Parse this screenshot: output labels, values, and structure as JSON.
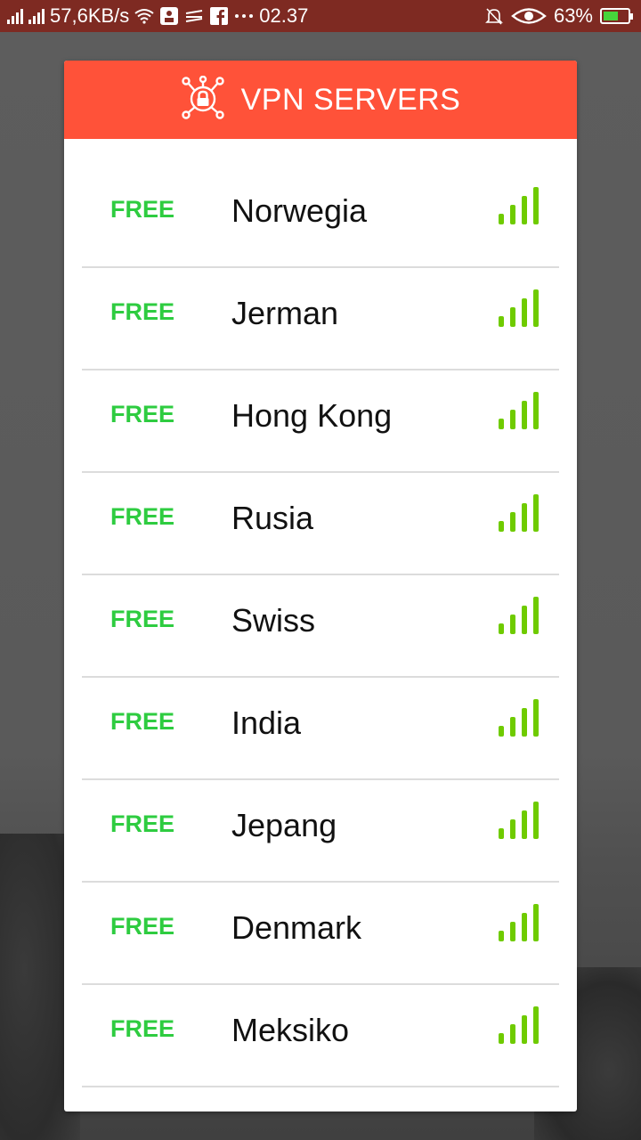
{
  "status_bar": {
    "network_speed": "57,6KB/s",
    "time": "02.37",
    "battery_percent": "63%",
    "battery_level": 0.63,
    "icons": [
      "signal-icon",
      "signal-icon",
      "wifi-icon",
      "notification-app-icon",
      "nav-app-icon",
      "facebook-icon",
      "more-dots-icon",
      "mute-bell-icon",
      "eye-icon",
      "battery-charging-icon"
    ]
  },
  "dialog": {
    "title": "VPN SERVERS",
    "header_icon": "vpn-lock-network-icon",
    "accent_color": "#ff5239"
  },
  "servers": [
    {
      "tag": "FREE",
      "name": "Norwegia",
      "signal_level": 4
    },
    {
      "tag": "FREE",
      "name": "Jerman",
      "signal_level": 4
    },
    {
      "tag": "FREE",
      "name": "Hong Kong",
      "signal_level": 4
    },
    {
      "tag": "FREE",
      "name": "Rusia",
      "signal_level": 4
    },
    {
      "tag": "FREE",
      "name": "Swiss",
      "signal_level": 4
    },
    {
      "tag": "FREE",
      "name": "India",
      "signal_level": 4
    },
    {
      "tag": "FREE",
      "name": "Jepang",
      "signal_level": 4
    },
    {
      "tag": "FREE",
      "name": "Denmark",
      "signal_level": 4
    },
    {
      "tag": "FREE",
      "name": "Meksiko",
      "signal_level": 4
    }
  ],
  "colors": {
    "free_tag": "#2ecc40",
    "signal_bars": "#6fcb00",
    "status_bar": "#7e2a22"
  }
}
